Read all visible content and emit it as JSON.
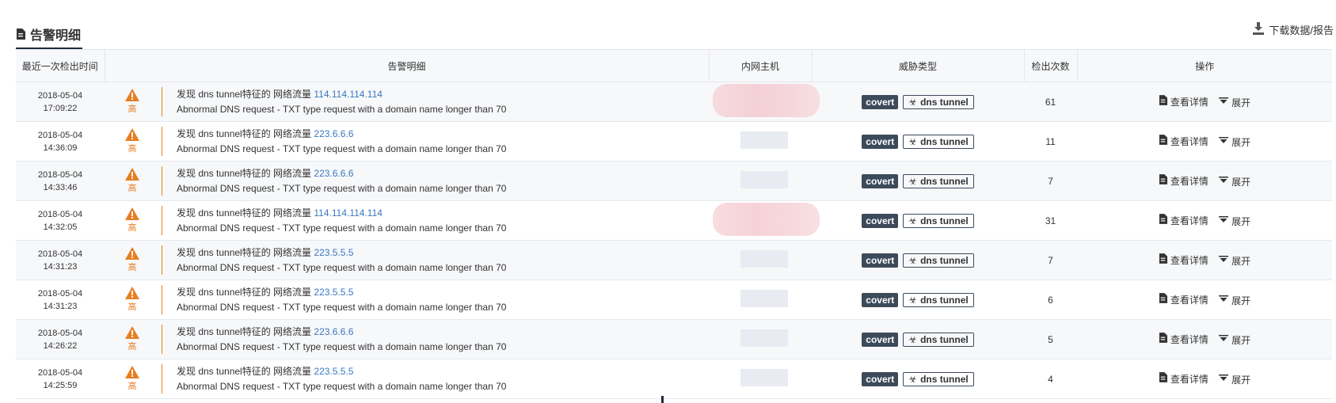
{
  "section": {
    "title": "告警明细",
    "download_label": "下载数据/报告"
  },
  "table": {
    "headers": {
      "time": "最近一次检出时间",
      "detail": "告警明细",
      "host": "内网主机",
      "threat": "威胁类型",
      "count": "检出次数",
      "ops": "操作"
    },
    "rows": [
      {
        "date": "2018-05-04",
        "time": "17:09:22",
        "level": "高",
        "prefix": "发现 dns tunnel特征的 网络流量",
        "ip": "114.114.114.114",
        "desc": "Abnormal DNS request - TXT type request with a domain name longer than 70",
        "tag1": "covert",
        "tag2": "dns tunnel",
        "count": "61",
        "view": "查看详情",
        "expand": "展开"
      },
      {
        "date": "2018-05-04",
        "time": "14:36:09",
        "level": "高",
        "prefix": "发现 dns tunnel特征的 网络流量",
        "ip": "223.6.6.6",
        "desc": "Abnormal DNS request - TXT type request with a domain name longer than 70",
        "tag1": "covert",
        "tag2": "dns tunnel",
        "count": "11",
        "view": "查看详情",
        "expand": "展开"
      },
      {
        "date": "2018-05-04",
        "time": "14:33:46",
        "level": "高",
        "prefix": "发现 dns tunnel特征的 网络流量",
        "ip": "223.6.6.6",
        "desc": "Abnormal DNS request - TXT type request with a domain name longer than 70",
        "tag1": "covert",
        "tag2": "dns tunnel",
        "count": "7",
        "view": "查看详情",
        "expand": "展开"
      },
      {
        "date": "2018-05-04",
        "time": "14:32:05",
        "level": "高",
        "prefix": "发现 dns tunnel特征的 网络流量",
        "ip": "114.114.114.114",
        "desc": "Abnormal DNS request - TXT type request with a domain name longer than 70",
        "tag1": "covert",
        "tag2": "dns tunnel",
        "count": "31",
        "view": "查看详情",
        "expand": "展开"
      },
      {
        "date": "2018-05-04",
        "time": "14:31:23",
        "level": "高",
        "prefix": "发现 dns tunnel特征的 网络流量",
        "ip": "223.5.5.5",
        "desc": "Abnormal DNS request - TXT type request with a domain name longer than 70",
        "tag1": "covert",
        "tag2": "dns tunnel",
        "count": "7",
        "view": "查看详情",
        "expand": "展开"
      },
      {
        "date": "2018-05-04",
        "time": "14:31:23",
        "level": "高",
        "prefix": "发现 dns tunnel特征的 网络流量",
        "ip": "223.5.5.5",
        "desc": "Abnormal DNS request - TXT type request with a domain name longer than 70",
        "tag1": "covert",
        "tag2": "dns tunnel",
        "count": "6",
        "view": "查看详情",
        "expand": "展开"
      },
      {
        "date": "2018-05-04",
        "time": "14:26:22",
        "level": "高",
        "prefix": "发现 dns tunnel特征的 网络流量",
        "ip": "223.6.6.6",
        "desc": "Abnormal DNS request - TXT type request with a domain name longer than 70",
        "tag1": "covert",
        "tag2": "dns tunnel",
        "count": "5",
        "view": "查看详情",
        "expand": "展开"
      },
      {
        "date": "2018-05-04",
        "time": "14:25:59",
        "level": "高",
        "prefix": "发现 dns tunnel特征的 网络流量",
        "ip": "223.5.5.5",
        "desc": "Abnormal DNS request - TXT type request with a domain name longer than 70",
        "tag1": "covert",
        "tag2": "dns tunnel",
        "count": "4",
        "view": "查看详情",
        "expand": "展开"
      }
    ]
  },
  "colors": {
    "warning": "#e67e22",
    "link": "#3a78c3",
    "tag_dark": "#3d4a5a"
  },
  "icons": {
    "title": "document-icon",
    "download": "download-icon",
    "level": "warning-triangle-icon",
    "tag": "biohazard-icon",
    "view": "document-icon",
    "expand": "filter-icon"
  }
}
